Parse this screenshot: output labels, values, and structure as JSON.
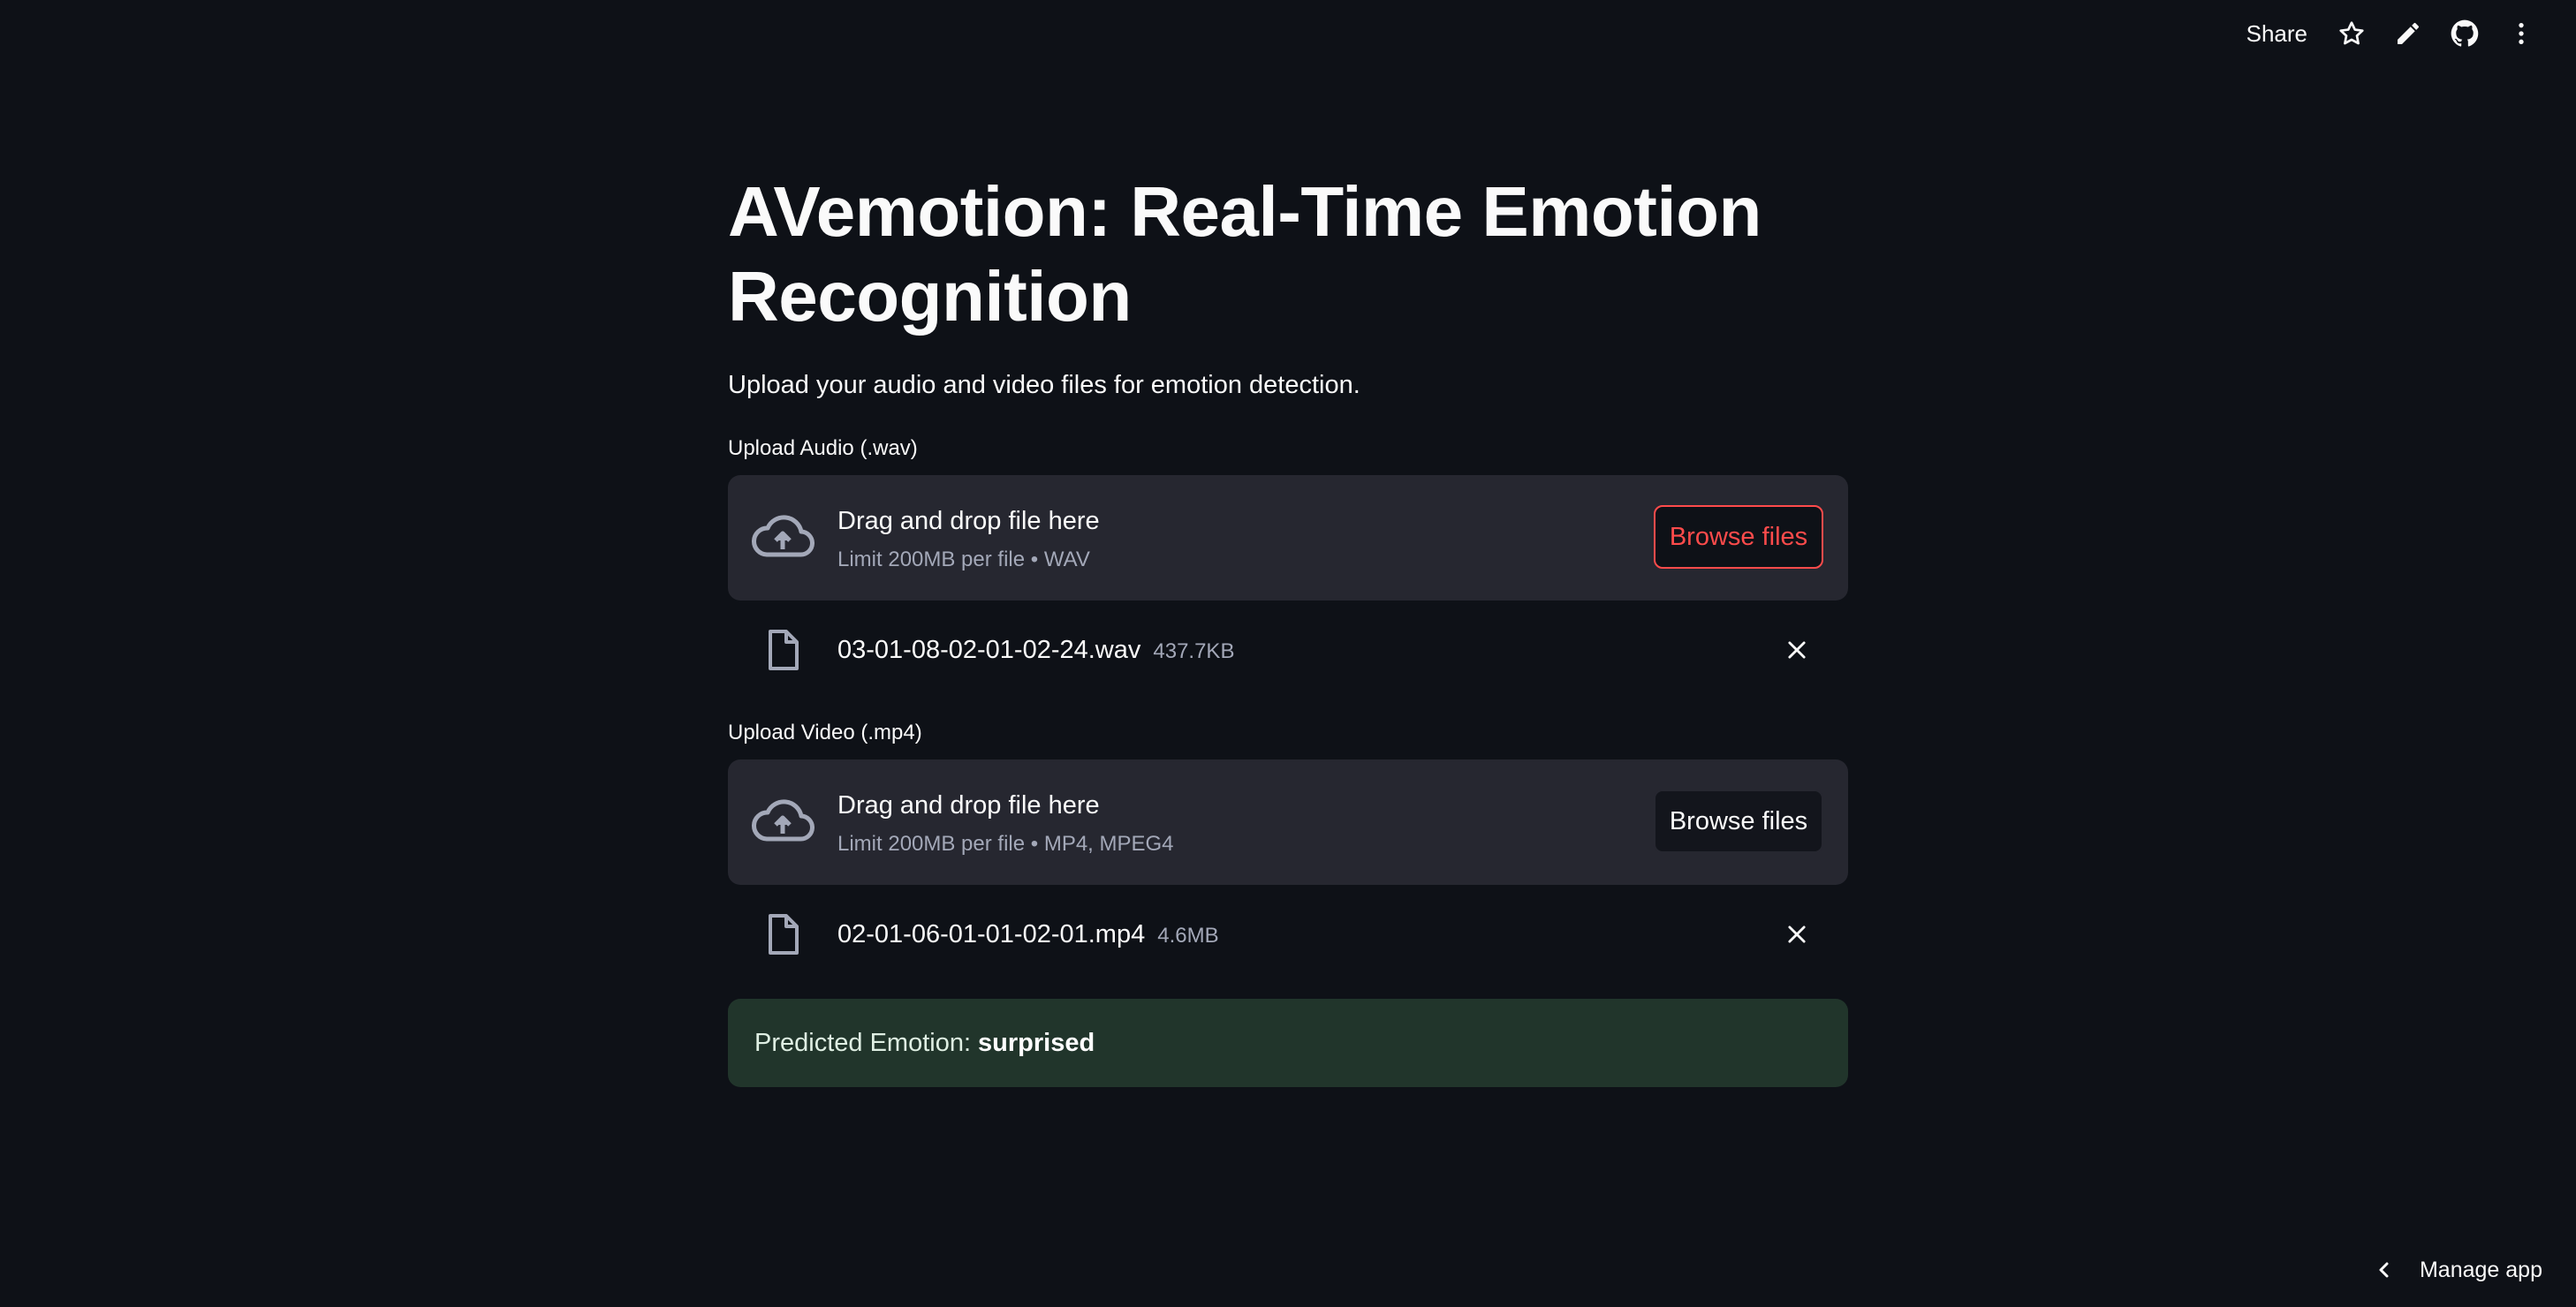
{
  "toolbar": {
    "share_label": "Share",
    "icons": [
      "star-icon",
      "pencil-icon",
      "github-icon",
      "more-vertical-icon"
    ]
  },
  "page": {
    "title": "AVemotion: Real-Time Emotion Recognition",
    "subtitle": "Upload your audio and video files for emotion detection."
  },
  "audio_upload": {
    "label": "Upload Audio (.wav)",
    "drop_title": "Drag and drop file here",
    "limit": "Limit 200MB per file • WAV",
    "browse_label": "Browse files",
    "file": {
      "name": "03-01-08-02-01-02-24.wav",
      "size": "437.7KB"
    }
  },
  "video_upload": {
    "label": "Upload Video (.mp4)",
    "drop_title": "Drag and drop file here",
    "limit": "Limit 200MB per file • MP4, MPEG4",
    "browse_label": "Browse files",
    "file": {
      "name": "02-01-06-01-01-02-01.mp4",
      "size": "4.6MB"
    }
  },
  "result": {
    "prefix": "Predicted Emotion:",
    "emotion": "surprised"
  },
  "footer": {
    "manage_label": "Manage app"
  },
  "colors": {
    "background": "#0e1117",
    "surface": "#262730",
    "accent": "#ff4b4b",
    "success_bg": "#21352b"
  }
}
